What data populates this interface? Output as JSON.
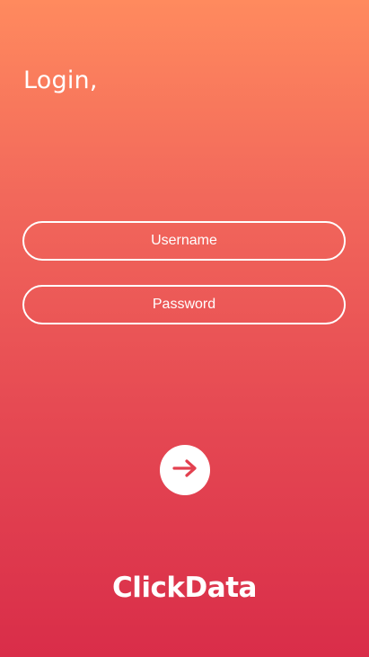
{
  "header": {
    "title": "Login,"
  },
  "form": {
    "username_placeholder": "Username",
    "password_placeholder": "Password"
  },
  "submit": {
    "icon": "arrow-right-icon"
  },
  "brand": {
    "logo_text": "ClickData"
  },
  "colors": {
    "gradient_top": "#FF8A5E",
    "gradient_bottom": "#D92D49",
    "accent": "#E3404F",
    "foreground": "#FFFFFF"
  }
}
